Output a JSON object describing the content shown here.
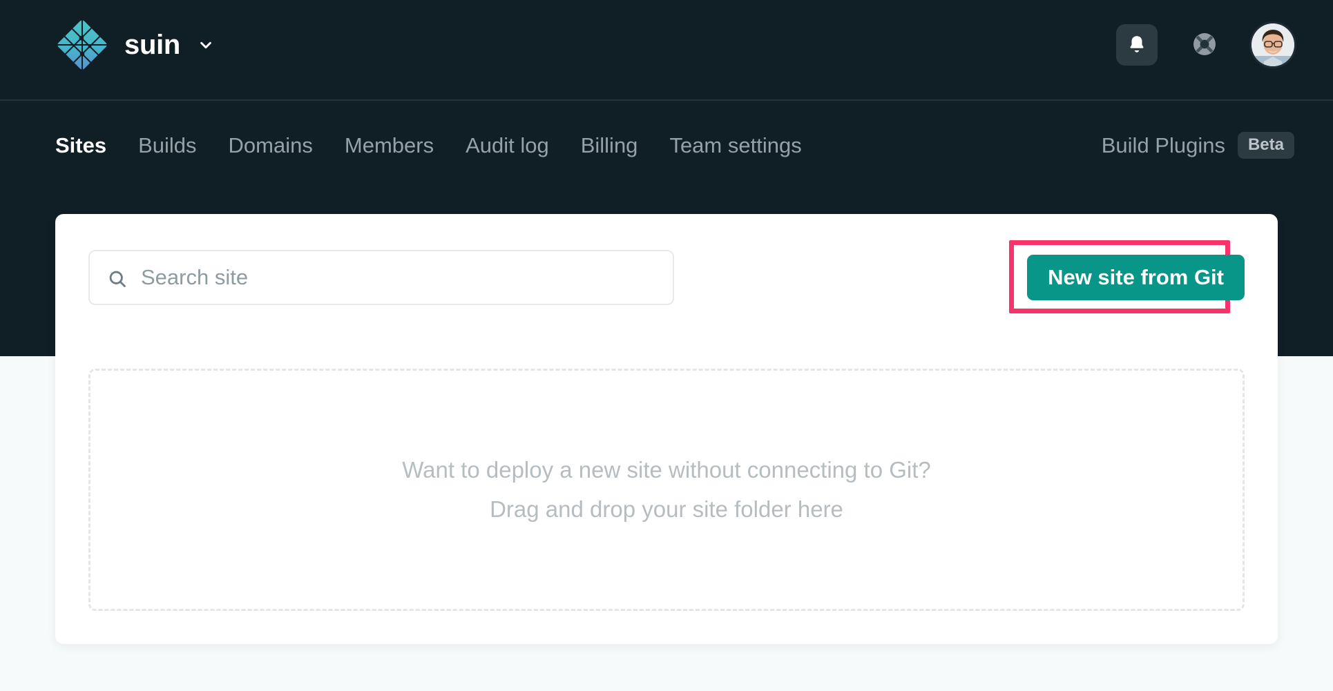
{
  "header": {
    "brand": {
      "name": "suin",
      "logo_icon": "netlify-diamond-logo",
      "caret_icon": "chevron-down-icon"
    },
    "actions": [
      {
        "name": "notifications",
        "icon": "bell-icon"
      },
      {
        "name": "help",
        "icon": "lifebuoy-icon"
      },
      {
        "name": "account",
        "icon": "avatar"
      }
    ]
  },
  "nav": {
    "items": [
      {
        "label": "Sites",
        "active": true
      },
      {
        "label": "Builds",
        "active": false
      },
      {
        "label": "Domains",
        "active": false
      },
      {
        "label": "Members",
        "active": false
      },
      {
        "label": "Audit log",
        "active": false
      },
      {
        "label": "Billing",
        "active": false
      },
      {
        "label": "Team settings",
        "active": false
      }
    ],
    "right": {
      "label": "Build Plugins",
      "badge": "Beta"
    }
  },
  "main": {
    "search": {
      "value": "",
      "placeholder": "Search site",
      "icon": "search-icon"
    },
    "new_site_button": {
      "label": "New site from Git",
      "highlighted": true
    },
    "dropzone": {
      "line1": "Want to deploy a new site without connecting to Git?",
      "line2": "Drag and drop your site folder here"
    }
  },
  "colors": {
    "header_bg": "#101e25",
    "page_bg": "#f7fafa",
    "accent_teal": "#089688",
    "highlight_pink": "#f6336b",
    "nav_inactive": "#96a2a8",
    "muted_text": "#b6bdc1"
  }
}
